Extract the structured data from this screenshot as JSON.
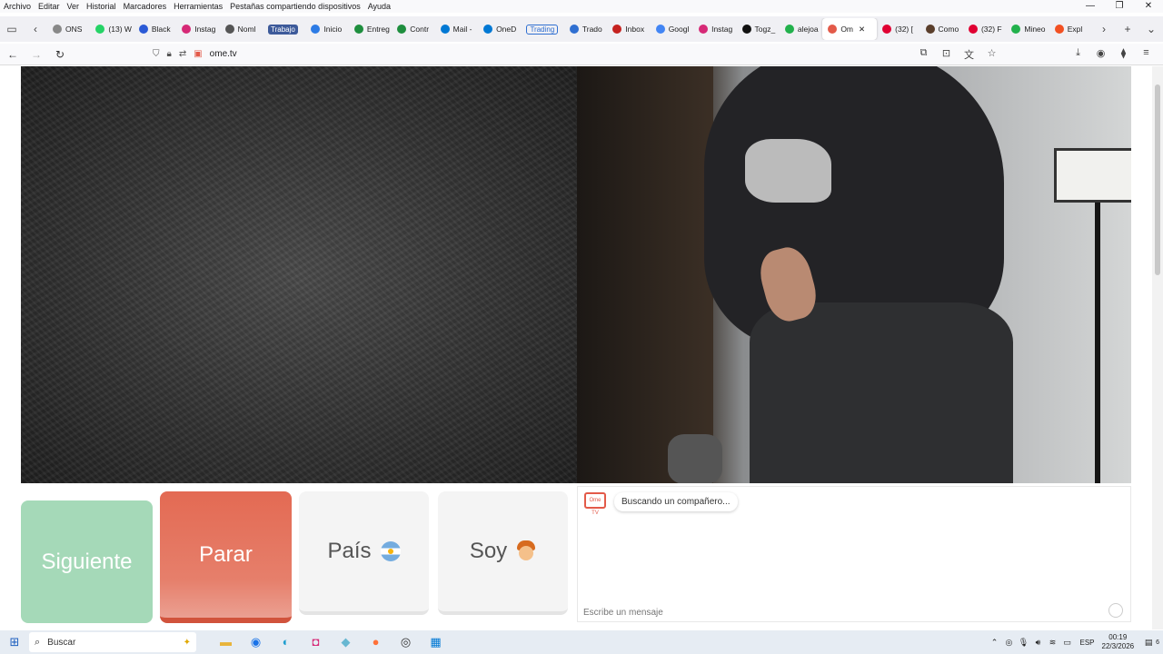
{
  "menubar": {
    "items": [
      "Archivo",
      "Editar",
      "Ver",
      "Historial",
      "Marcadores",
      "Herramientas",
      "Pestañas compartiendo dispositivos",
      "Ayuda"
    ]
  },
  "tabs": [
    {
      "label": "ONS",
      "color": "#888888"
    },
    {
      "label": "(13) W",
      "color": "#25d366"
    },
    {
      "label": "Black",
      "color": "#2b5ad6"
    },
    {
      "label": "Instag",
      "color": "#d62976"
    },
    {
      "label": "Noml",
      "color": "#555555"
    },
    {
      "label": "Trabajo",
      "color": "#3d5a9a"
    },
    {
      "label": "Inicio",
      "color": "#2c7be5"
    },
    {
      "label": "Entreg",
      "color": "#1e8e3e"
    },
    {
      "label": "Contr",
      "color": "#1e8e3e"
    },
    {
      "label": "Mail -",
      "color": "#0078d4"
    },
    {
      "label": "OneD",
      "color": "#0078d4"
    },
    {
      "label": "Trading",
      "color": "#2f6fd1"
    },
    {
      "label": "Trado",
      "color": "#2f6fd1"
    },
    {
      "label": "Inbox",
      "color": "#c5221f"
    },
    {
      "label": "Googl",
      "color": "#4285f4"
    },
    {
      "label": "Instag",
      "color": "#d62976"
    },
    {
      "label": "Togz_",
      "color": "#111111"
    },
    {
      "label": "alejoa",
      "color": "#22b14c"
    },
    {
      "label": "Om",
      "color": "#e35a49"
    },
    {
      "label": "(32) [",
      "color": "#e00032"
    },
    {
      "label": "Como",
      "color": "#5a3e2b"
    },
    {
      "label": "(32) F",
      "color": "#e00032"
    },
    {
      "label": "Mineo",
      "color": "#22b14c"
    },
    {
      "label": "Expl",
      "color": "#f25022"
    }
  ],
  "address": {
    "url": "ome.tv"
  },
  "controls": {
    "next": "Siguiente",
    "stop": "Parar",
    "country": "País",
    "gender": "Soy"
  },
  "chat": {
    "status": "Buscando un compañero...",
    "placeholder": "Escribe un mensaje",
    "icon_text": "Ome TV"
  },
  "taskbar": {
    "search": "Buscar",
    "lang": "ESP",
    "time": "00:19",
    "date": "22/3/2026",
    "notif_count": "6"
  },
  "colors": {
    "next": "#a5d9b8",
    "stop": "#e36a53",
    "accent": "#e35a49"
  }
}
